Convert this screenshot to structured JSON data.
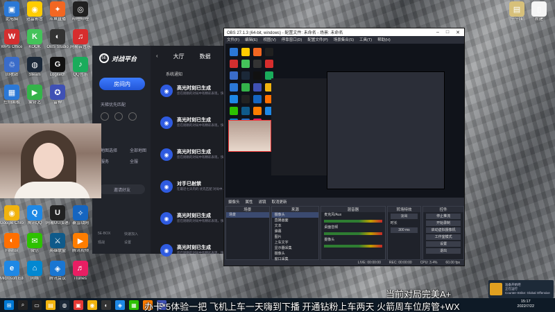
{
  "desktop": {
    "icons_left": [
      {
        "label": "此电脑",
        "color": "#2b78d6",
        "glyph": "▣"
      },
      {
        "label": "迅雷影音",
        "color": "#ffcc00",
        "glyph": "◉"
      },
      {
        "label": "斗鱼直播",
        "color": "#f26722",
        "glyph": "✦"
      },
      {
        "label": "哔哩哔哩",
        "color": "#202020",
        "glyph": "◎"
      },
      {
        "label": "WPS Office",
        "color": "#d32f2f",
        "glyph": "W"
      },
      {
        "label": "KOOK",
        "color": "#44c35a",
        "glyph": "K"
      },
      {
        "label": "OBS Studio",
        "color": "#333",
        "glyph": "◐"
      },
      {
        "label": "网易云音乐",
        "color": "#d72d2d",
        "glyph": "♫"
      },
      {
        "label": "回收站",
        "color": "#3a6cc9",
        "glyph": "♲"
      },
      {
        "label": "Steam",
        "color": "#1b2838",
        "glyph": "◍"
      },
      {
        "label": "Logitech",
        "color": "#111",
        "glyph": "G"
      },
      {
        "label": "QQ音乐",
        "color": "#1aac5b",
        "glyph": "♪"
      },
      {
        "label": "控制面板",
        "color": "#2b78d6",
        "glyph": "▦"
      },
      {
        "label": "爱奇艺",
        "color": "#34b34a",
        "glyph": "▶"
      },
      {
        "label": "雷神",
        "color": "#3f51b5",
        "glyph": "✪"
      }
    ],
    "icons_bottom": [
      {
        "label": "Google Chrome",
        "color": "#f1b30e",
        "glyph": "◉"
      },
      {
        "label": "腾讯QQ",
        "color": "#1e88e5",
        "glyph": "Q"
      },
      {
        "label": "网易UU加速器",
        "color": "#222",
        "glyph": "U"
      },
      {
        "label": "暴雪战网",
        "color": "#1565c0",
        "glyph": "✧"
      },
      {
        "label": "Firefox",
        "color": "#ff6f00",
        "glyph": "◐"
      },
      {
        "label": "微信",
        "color": "#2dc100",
        "glyph": "✉"
      },
      {
        "label": "英雄联盟",
        "color": "#0f5a8a",
        "glyph": "⚔"
      },
      {
        "label": "腾讯视频",
        "color": "#ff7d00",
        "glyph": "▶"
      },
      {
        "label": "Microsoft Edge",
        "color": "#1e88e5",
        "glyph": "e"
      },
      {
        "label": "网络",
        "color": "#0288d1",
        "glyph": "⌂"
      },
      {
        "label": "腾讯会议",
        "color": "#1976d2",
        "glyph": "◈"
      },
      {
        "label": "iTunes",
        "color": "#e91e63",
        "glyph": "♬"
      }
    ],
    "icons_right": [
      {
        "label": "牛牛压",
        "color": "#d7c07a",
        "glyph": "▤"
      },
      {
        "label": "新建",
        "color": "#f5f5f5",
        "glyph": "▯"
      }
    ]
  },
  "app": {
    "logo_mark": "5E",
    "logo_name": "对战平台",
    "room_button": "房间内",
    "priority_label": "天梯优先匹配",
    "map_label": "地图选择",
    "map_value": "全部地图",
    "mode_label": "服务",
    "mode_value": "全服",
    "invite_button": "邀请好友",
    "footer": [
      "5E-BOX",
      "快速加入",
      "观战",
      "设置"
    ],
    "tabs": {
      "back": "‹",
      "lobby": "大厅",
      "data": "数据"
    },
    "section_title": "系统通知",
    "notices": [
      {
        "title": "高光时刻已生成",
        "desc": "您在刚刚的对局中有精彩表现，快去查看吧"
      },
      {
        "title": "高光时刻已生成",
        "desc": "您在刚刚的对局中有精彩表现，快去查看吧"
      },
      {
        "title": "高光时刻已生成",
        "desc": "您在刚刚的对局中有精彩表现，快去查看吧"
      },
      {
        "title": "对手已射禁",
        "desc": "在最近七天内的 优先匹配 对局中…"
      },
      {
        "title": "高光时刻已生成",
        "desc": "您在刚刚的对局中有精彩表现，快去查看吧"
      },
      {
        "title": "高光时刻已生成",
        "desc": "您在刚刚的对局中有精彩表现，快去查看吧"
      }
    ]
  },
  "obs": {
    "title": "OBS 27.1.3 (64-bit, windows) - 配置文件: 未命名 - 场景: 未命名",
    "menu": [
      "文件(F)",
      "编辑(E)",
      "视图(V)",
      "停靠窗口(D)",
      "配置文件(P)",
      "场景集合(S)",
      "工具(T)",
      "帮助(H)"
    ],
    "source_bar": [
      "摄像头",
      "属性",
      "滤镜",
      "取消更新"
    ],
    "docks": {
      "scenes": {
        "title": "场景",
        "items": [
          "场景"
        ]
      },
      "sources": {
        "title": "来源",
        "items": [
          "摄像头",
          "直播画面",
          "文本",
          "弹幕",
          "图片",
          "上车文字",
          "显示器采集",
          "摄像头",
          "窗口采集"
        ]
      },
      "mixer": {
        "title": "混音器",
        "items": [
          "麦克风/Aux",
          "桌面音频",
          "摄像头"
        ]
      },
      "transitions": {
        "title": "转场特效",
        "type": "淡出",
        "duration_label": "时长",
        "duration": "300 ms"
      },
      "controls": {
        "title": "控件",
        "buttons": [
          "停止推流",
          "开始录制",
          "启动虚拟摄像机",
          "工作室模式",
          "设置",
          "退出"
        ]
      }
    },
    "status": [
      "LIVE: 00:00:00",
      "REC: 00:00:00",
      "CPU: 3.4%",
      "60.00 fps"
    ]
  },
  "overlay": {
    "line1": "当前对局完美A+",
    "line2": "办卡*5体验一把 飞机上车一天嗨到下播 开通钻粉上车两天 火箭周车位房管+WX"
  },
  "notification": {
    "title": "准备开始吧",
    "line1": "正在运行",
    "line2": "Counter-Strike: Global Offensive"
  },
  "taskbar": {
    "time": "15:17",
    "date": "2022/7/22",
    "apps": [
      {
        "color": "#0078d4",
        "glyph": "⊞"
      },
      {
        "color": "#222",
        "glyph": "⌕"
      },
      {
        "color": "#222",
        "glyph": "▭"
      },
      {
        "color": "#f1b30e",
        "glyph": "▤"
      },
      {
        "color": "#1b2838",
        "glyph": "◍"
      },
      {
        "color": "#e53935",
        "glyph": "▣"
      },
      {
        "color": "#f1b30e",
        "glyph": "◉"
      },
      {
        "color": "#333",
        "glyph": "◐"
      },
      {
        "color": "#1e88e5",
        "glyph": "◈"
      },
      {
        "color": "#2dc100",
        "glyph": "▦"
      },
      {
        "color": "#ff7d00",
        "glyph": "✦"
      },
      {
        "color": "#3f51b5",
        "glyph": "✪"
      }
    ]
  }
}
